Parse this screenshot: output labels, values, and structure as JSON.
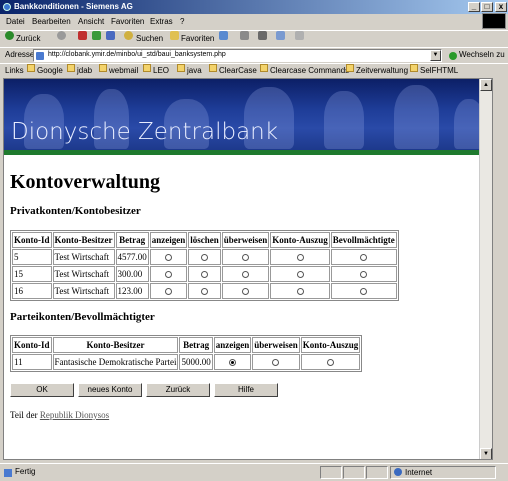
{
  "window": {
    "title": "Bankkonditionen - Siemens AG",
    "minimize": "_",
    "maximize": "□",
    "close": "x"
  },
  "menu": [
    "Datei",
    "Bearbeiten",
    "Ansicht",
    "Favoriten",
    "Extras",
    "?"
  ],
  "toolbar": {
    "back": "Zurück",
    "search": "Suchen",
    "favorites": "Favoriten"
  },
  "address": {
    "label": "Adresse",
    "url": "http://clobank.ymir.de/minbo/ui_std/baui_banksystem.php",
    "go": "Wechseln zu"
  },
  "links": {
    "label": "Links",
    "items": [
      "Google",
      "jdab",
      "webmail",
      "LEO",
      "java",
      "ClearCase",
      "Clearcase Commands",
      "Zeitverwaltung",
      "SelFHTML"
    ]
  },
  "banner": {
    "title": "Dionysche Zentralbank"
  },
  "page": {
    "title": "Kontoverwaltung",
    "private_heading": "Privatkonten/Kontobesitzer",
    "private_headers": [
      "Konto-Id",
      "Konto-Besitzer",
      "Betrag",
      "anzeigen",
      "löschen",
      "überweisen",
      "Konto-Auszug",
      "Bevollmächtigte"
    ],
    "private_rows": [
      {
        "id": "5",
        "owner": "Test Wirtschaft",
        "amount": "4577.00"
      },
      {
        "id": "15",
        "owner": "Test Wirtschaft",
        "amount": "300.00"
      },
      {
        "id": "16",
        "owner": "Test Wirtschaft",
        "amount": "123.00"
      }
    ],
    "party_heading": "Parteikonten/Bevollmächtigter",
    "party_headers": [
      "Konto-Id",
      "Konto-Besitzer",
      "Betrag",
      "anzeigen",
      "überweisen",
      "Konto-Auszug"
    ],
    "party_rows": [
      {
        "id": "11",
        "owner": "Fantasische Demokratische Partei",
        "amount": "5000.00",
        "selected": "anzeigen"
      }
    ],
    "buttons": [
      "OK",
      "neues Konto",
      "Zurück",
      "Hilfe"
    ],
    "footer_text": "Teil der",
    "footer_link": "Republik Dionysos"
  },
  "status": {
    "text": "Fertig",
    "zone": "Internet"
  },
  "colors": {
    "titlebar": "#0a246a",
    "banner": "#1e3d98",
    "banner_strip": "#1f7a2e",
    "chrome": "#d4d0c8"
  }
}
